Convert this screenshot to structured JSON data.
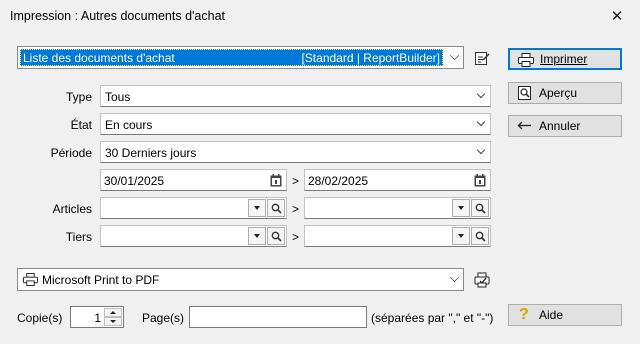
{
  "window": {
    "title": "Impression : Autres documents d'achat",
    "close_glyph": "✕"
  },
  "report": {
    "name": "Liste des documents d'achat",
    "kind": "[Standard | ReportBuilder]"
  },
  "fields": {
    "type_label": "Type",
    "type_value": "Tous",
    "etat_label": "État",
    "etat_value": "En cours",
    "periode_label": "Période",
    "periode_value": "30 Derniers jours",
    "date_from": "30/01/2025",
    "date_to": "28/02/2025",
    "articles_label": "Articles",
    "tiers_label": "Tiers",
    "range_sep": ">"
  },
  "buttons": {
    "print": "Imprimer",
    "preview": "Aperçu",
    "cancel": "Annuler",
    "help": "Aide"
  },
  "printer": {
    "name": "Microsoft Print to PDF"
  },
  "copies": {
    "label": "Copie(s)",
    "value": "1"
  },
  "pages": {
    "label": "Page(s)",
    "hint": "(séparées par \",\" et \"-\")",
    "value": ""
  },
  "colors": {
    "accent": "#0078d7",
    "help_icon": "#d9a300"
  }
}
